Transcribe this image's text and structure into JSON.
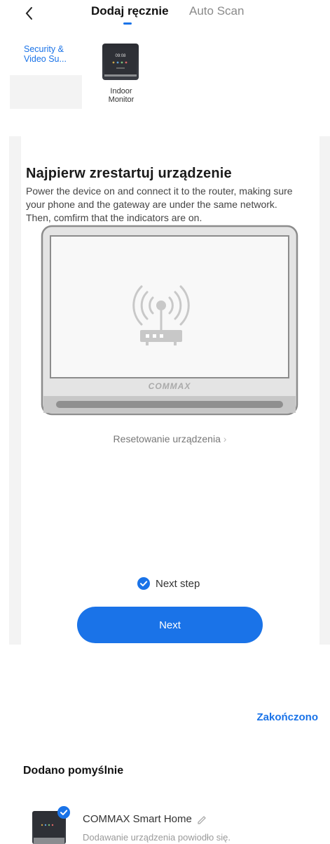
{
  "nav": {
    "back_icon": "chevron-left-icon",
    "tab_active": "Dodaj ręcznie",
    "tab_inactive": "Auto Scan",
    "accent": "#1a73e8"
  },
  "category": {
    "label": "Security & Video Su..."
  },
  "product": {
    "label": "Indoor Monitor",
    "screen_time": "09:08"
  },
  "card": {
    "title": "Najpierw zrestartuj urządzenie",
    "description": "Power the device on and connect it to the router, making sure your phone and the gateway are under the same network. Then, comfirm that the indicators are on.",
    "monitor_brand": "COMMAX",
    "reset_link": "Resetowanie urządzenia",
    "reset_chevron": "›",
    "checkbox_label": "Next step",
    "checkbox_checked": true,
    "next_button": "Next"
  },
  "footer": {
    "done_label": "Zakończono",
    "success_title": "Dodano pomyślnie",
    "device_name": "COMMAX Smart Home",
    "device_status": "Dodawanie urządzenia powiodło się."
  }
}
